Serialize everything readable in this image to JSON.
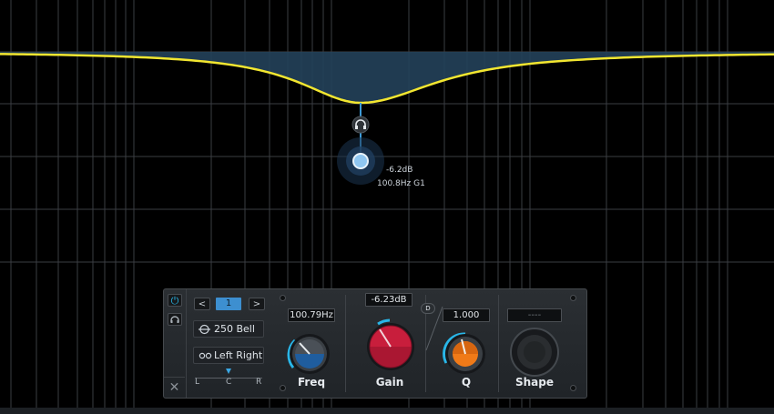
{
  "graph": {
    "band_readout": {
      "gain": "-6.2dB",
      "freq": "100.8Hz G1"
    }
  },
  "panel": {
    "power_icon": "power-icon",
    "listen_icon": "headphones-icon",
    "close_label": "✕",
    "band_nav": {
      "prev_label": "<",
      "next_label": ">",
      "band_number": "1"
    },
    "filter_type": {
      "icon": "bell-filter-icon",
      "label": "250 Bell"
    },
    "channel_mode": {
      "icon": "stereo-icon",
      "label": "Left Right"
    },
    "pan": {
      "left": "L",
      "center": "C",
      "right": "R"
    },
    "freq": {
      "value": "100.79Hz",
      "label": "Freq",
      "color": "#1f5d9e"
    },
    "gain": {
      "value": "-6.23dB",
      "label": "Gain",
      "color": "#c81e3c",
      "dynamic_badge": "D"
    },
    "q": {
      "value": "1.000",
      "label": "Q",
      "color": "#f07a18"
    },
    "shape": {
      "value": "----",
      "label": "Shape",
      "color": "#2a2d30"
    }
  },
  "colors": {
    "accent": "#29b6e8",
    "curve": "#f2e630",
    "fill": "#24415a"
  }
}
